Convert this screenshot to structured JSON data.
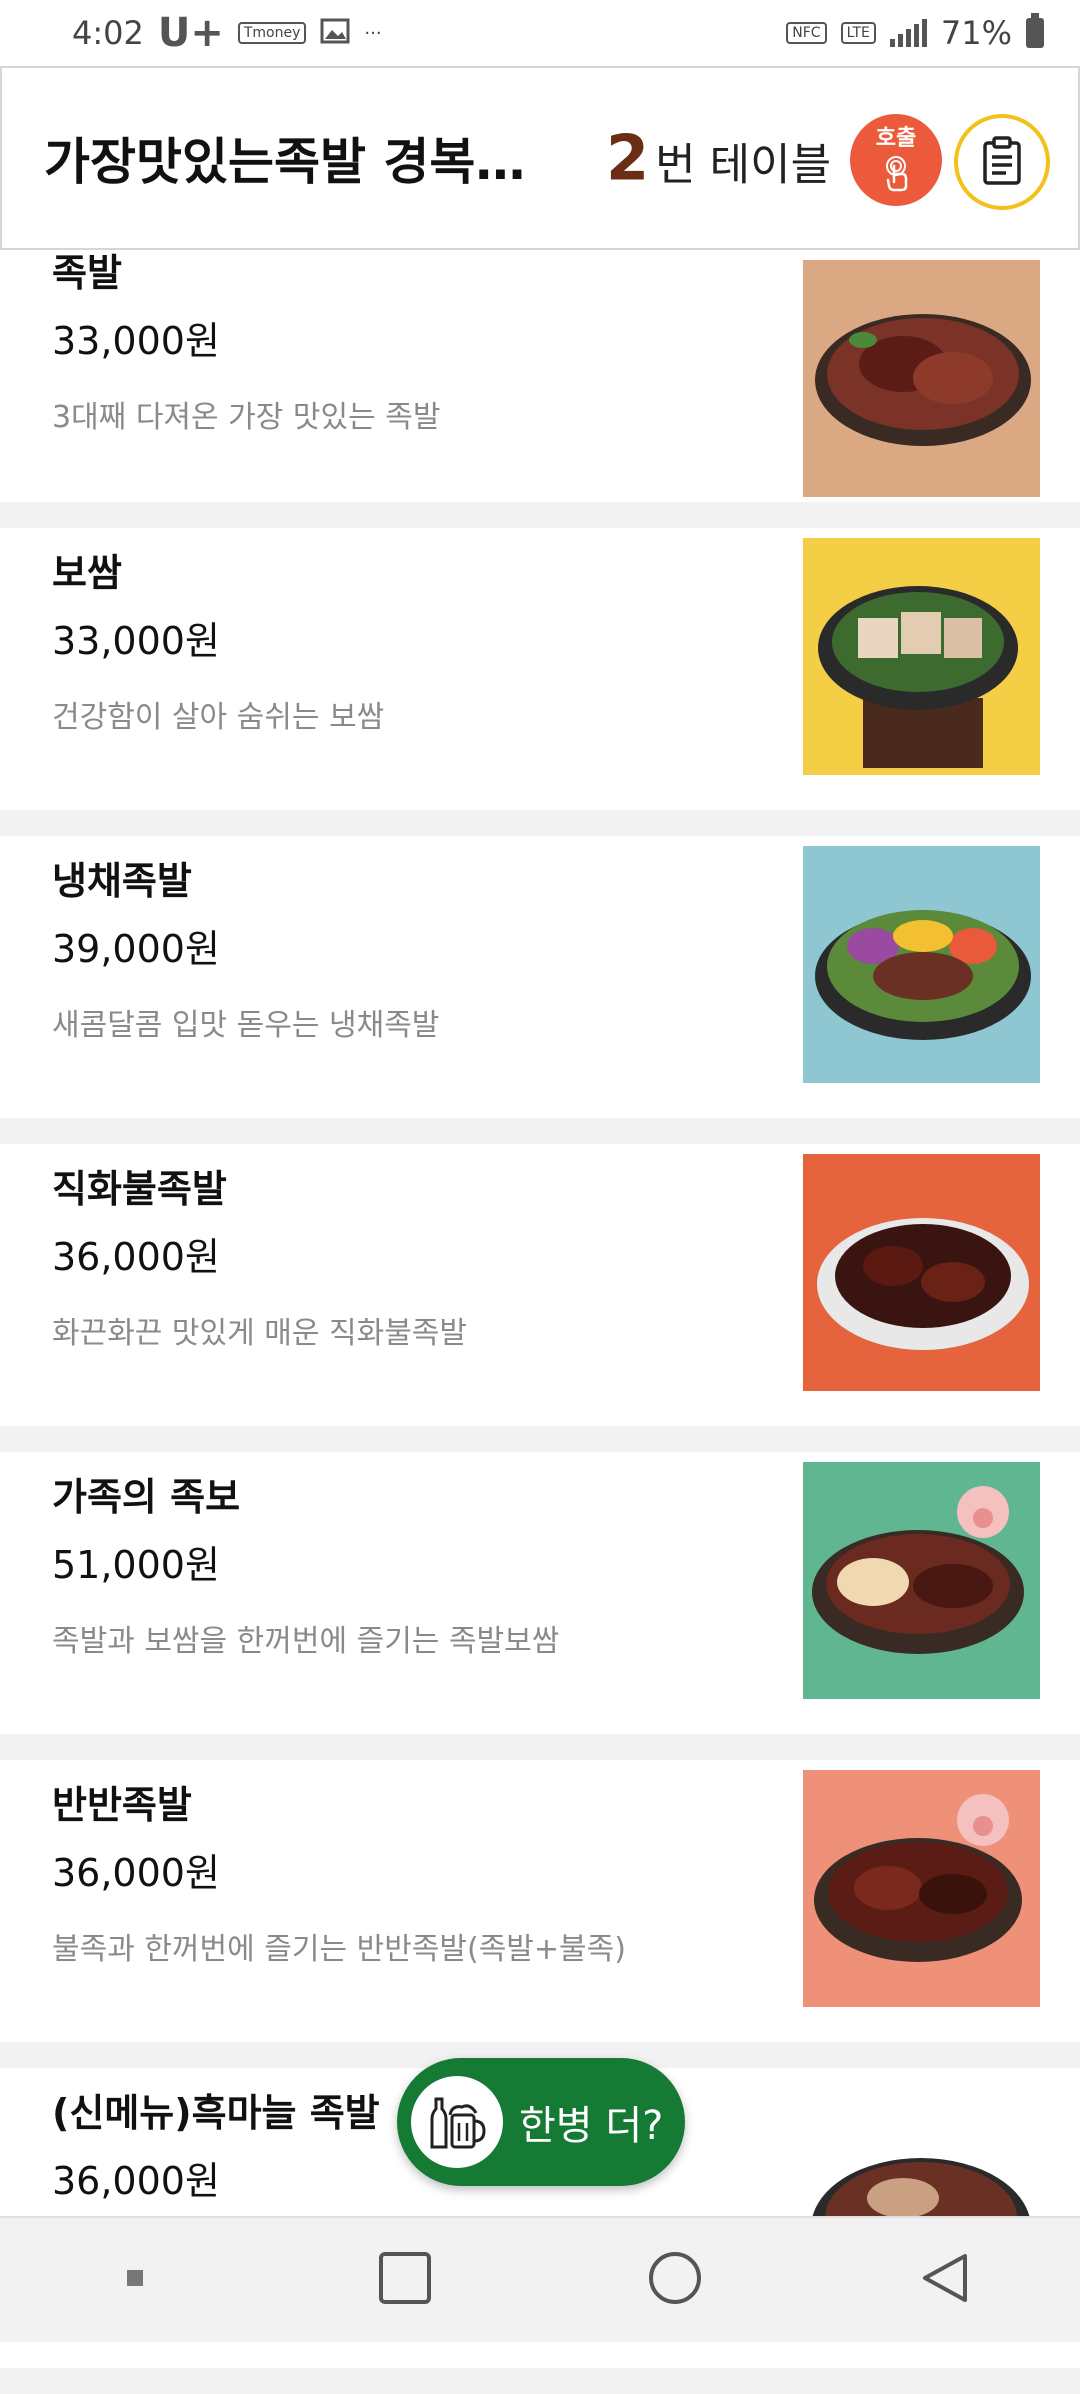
{
  "status_bar": {
    "time": "4:02",
    "carrier": "U+",
    "chip": "Tmoney",
    "more": "···",
    "nfc": "NFC",
    "lte": "LTE",
    "battery": "71%"
  },
  "header": {
    "store_name": "가장맛있는족발 경복…",
    "table_number": "2",
    "table_label": "번 테이블",
    "call_label": "호출"
  },
  "menu": [
    {
      "name": "족발",
      "price": "33,000원",
      "desc": "3대째 다져온 가장 맛있는 족발",
      "bg": "#dba884"
    },
    {
      "name": "보쌈",
      "price": "33,000원",
      "desc": "건강함이 살아 숨쉬는 보쌈",
      "bg": "#f4cf45"
    },
    {
      "name": "냉채족발",
      "price": "39,000원",
      "desc": "새콤달콤 입맛 돋우는 냉채족발",
      "bg": "#8ec6d2"
    },
    {
      "name": "직화불족발",
      "price": "36,000원",
      "desc": "화끈화끈 맛있게 매운 직화불족발",
      "bg": "#e5633d"
    },
    {
      "name": "가족의 족보",
      "price": "51,000원",
      "desc": "족발과 보쌈을 한꺼번에 즐기는 족발보쌈",
      "bg": "#5fb690"
    },
    {
      "name": "반반족발",
      "price": "36,000원",
      "desc": "불족과 한꺼번에 즐기는 반반족발(족발+불족)",
      "bg": "#ee9178"
    },
    {
      "name": "(신메뉴)흑마늘 족발",
      "price": "36,000원",
      "desc": "",
      "bg": "#ffffff"
    }
  ],
  "float_button": {
    "label": "한병 더?",
    "color": "#157a33"
  },
  "colors": {
    "call_button": "#ec5a3c",
    "order_button_border": "#f2c11b",
    "table_number": "#6b2e14"
  }
}
